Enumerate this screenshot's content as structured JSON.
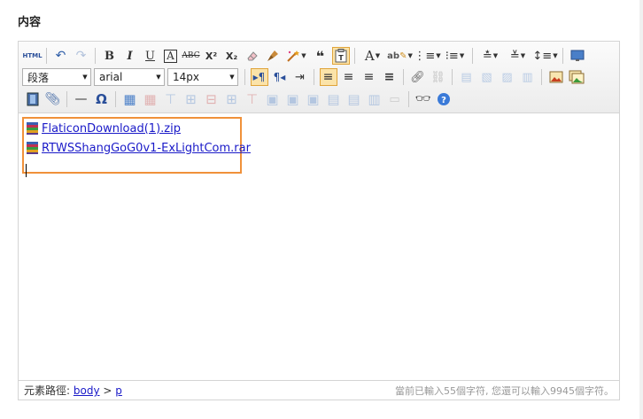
{
  "section": {
    "title": "内容"
  },
  "toolbar": {
    "html_label": "HTML",
    "paragraph_select": "段落",
    "font_select": "arial",
    "size_select": "14px",
    "quote_glyph": "❝"
  },
  "content": {
    "attachments": [
      {
        "name": "FlaticonDownload(1).zip"
      },
      {
        "name": "RTWSShangGoG0v1-ExLightCom.rar"
      }
    ]
  },
  "status": {
    "path_label": "元素路徑:",
    "path_body": "body",
    "path_sep": ">",
    "path_p": "p",
    "count_text": "當前已輸入55個字符, 您還可以輸入9945個字符。"
  }
}
